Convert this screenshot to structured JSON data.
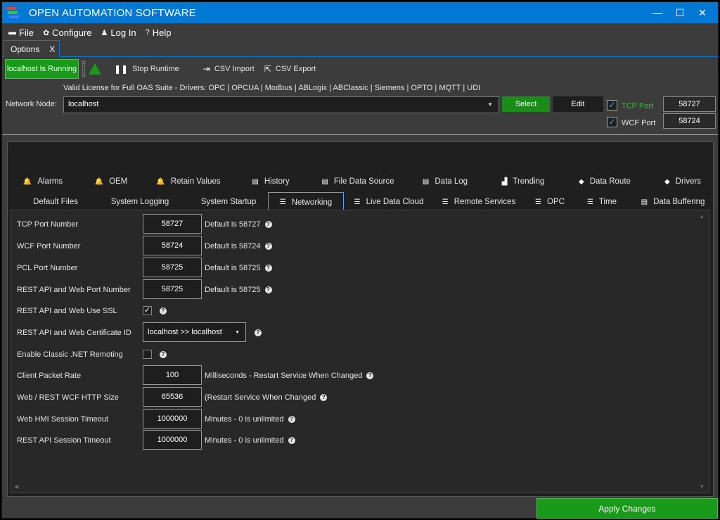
{
  "window": {
    "title": "OPEN AUTOMATION SOFTWARE",
    "controls": [
      "—",
      "☐",
      "✕"
    ]
  },
  "menu": [
    {
      "icon": "file-icon",
      "glyph": "▬",
      "label": "File"
    },
    {
      "icon": "gear-icon",
      "glyph": "✿",
      "label": "Configure"
    },
    {
      "icon": "user-icon",
      "glyph": "♟",
      "label": "Log In"
    },
    {
      "icon": "help-icon",
      "glyph": "?",
      "label": "Help"
    }
  ],
  "doc_tab": {
    "label": "Options",
    "close": "X"
  },
  "toolbar": {
    "running_label": "localhost Is Running",
    "stop_label": "Stop Runtime",
    "csv_import_label": "CSV Import",
    "csv_export_label": "CSV Export"
  },
  "license_text": "Valid License for Full OAS Suite - Drivers: OPC | OPCUA | Modbus | ABLogix | ABClassic | Siemens | OPTO | MQTT | UDI",
  "network": {
    "label": "Network Node:",
    "value": "localhost",
    "select_label": "Select",
    "edit_label": "Edit",
    "tcp_port_label": "TCP Port",
    "tcp_port_value": "58727",
    "tcp_checked": true,
    "wcf_port_label": "WCF Port",
    "wcf_port_value": "58724",
    "wcf_checked": true,
    "accent_green": "#2ec82e"
  },
  "tabs_row1": [
    {
      "icon": "bell-icon",
      "glyph": "🔔",
      "label": "Alarms"
    },
    {
      "icon": "bell-icon",
      "glyph": "🔔",
      "label": "OEM"
    },
    {
      "icon": "bell-icon",
      "glyph": "🔔",
      "label": "Retain Values"
    },
    {
      "icon": "table-icon",
      "glyph": "▤",
      "label": "History"
    },
    {
      "icon": "table-icon",
      "glyph": "▤",
      "label": "File Data Source"
    },
    {
      "icon": "table-icon",
      "glyph": "▤",
      "label": "Data Log"
    },
    {
      "icon": "chart-icon",
      "glyph": "▟",
      "label": "Trending"
    },
    {
      "icon": "pin-icon",
      "glyph": "◆",
      "label": "Data Route"
    },
    {
      "icon": "pin-icon",
      "glyph": "◆",
      "label": "Drivers"
    }
  ],
  "tabs_row2": [
    {
      "icon": "",
      "glyph": "",
      "label": "Default Files"
    },
    {
      "icon": "",
      "glyph": "",
      "label": "System Logging"
    },
    {
      "icon": "",
      "glyph": "",
      "label": "System Startup"
    },
    {
      "icon": "network-icon",
      "glyph": "☰",
      "label": "Networking",
      "active": true
    },
    {
      "icon": "network-icon",
      "glyph": "☰",
      "label": "Live Data Cloud"
    },
    {
      "icon": "network-icon",
      "glyph": "☰",
      "label": "Remote Services"
    },
    {
      "icon": "network-icon",
      "glyph": "☰",
      "label": "OPC"
    },
    {
      "icon": "network-icon",
      "glyph": "☰",
      "label": "Time"
    },
    {
      "icon": "table-icon",
      "glyph": "▤",
      "label": "Data Buffering"
    }
  ],
  "fields": {
    "tcp": {
      "label": "TCP Port Number",
      "value": "58727",
      "hint": "Default is 58727"
    },
    "wcf": {
      "label": "WCF Port Number",
      "value": "58724",
      "hint": "Default is 58724"
    },
    "pcl": {
      "label": "PCL Port Number",
      "value": "58725",
      "hint": "Default is 58725"
    },
    "rest_port": {
      "label": "REST API and Web Port Number",
      "value": "58725",
      "hint": "Default is 58725"
    },
    "rest_ssl": {
      "label": "REST API and Web Use SSL",
      "checked": true
    },
    "rest_cert": {
      "label": "REST API and Web Certificate ID",
      "value": "localhost >> localhost"
    },
    "remoting": {
      "label": "Enable Classic .NET Remoting",
      "checked": false
    },
    "packet_rate": {
      "label": "Client Packet Rate",
      "value": "100",
      "hint": "Milliseconds - Restart Service When Changed"
    },
    "http_size": {
      "label": "Web / REST WCF HTTP Size",
      "value": "65536",
      "hint": "(Restart Service When Changed"
    },
    "hmi_timeout": {
      "label": "Web HMI Session Timeout",
      "value": "1000000",
      "hint": "Minutes - 0 is unlimited"
    },
    "api_timeout": {
      "label": "REST API Session Timeout",
      "value": "1000000",
      "hint": "Minutes - 0 is unlimited"
    }
  },
  "apply_label": "Apply Changes"
}
